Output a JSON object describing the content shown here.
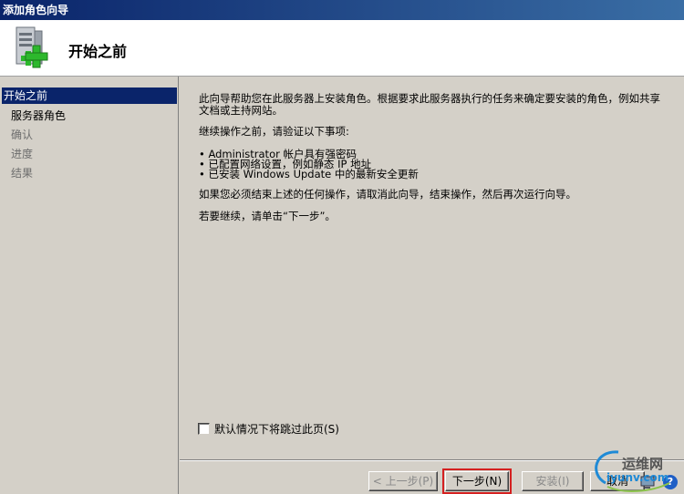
{
  "window": {
    "title": "添加角色向导"
  },
  "header": {
    "title": "开始之前",
    "icon": "server-add-icon"
  },
  "sidebar": {
    "items": [
      {
        "label": "开始之前",
        "state": "active"
      },
      {
        "label": "服务器角色",
        "state": "enabled"
      },
      {
        "label": "确认",
        "state": "disabled"
      },
      {
        "label": "进度",
        "state": "disabled"
      },
      {
        "label": "结果",
        "state": "disabled"
      }
    ]
  },
  "content": {
    "intro": "此向导帮助您在此服务器上安装角色。根据要求此服务器执行的任务来确定要安装的角色，例如共享文档或主持网站。",
    "verify_heading": "继续操作之前，请验证以下事项:",
    "bullets": [
      "• Administrator 帐户具有强密码",
      "• 已配置网络设置，例如静态 IP 地址",
      "• 已安装 Windows Update 中的最新安全更新"
    ],
    "cancel_note": "如果您必须结束上述的任何操作，请取消此向导，结束操作，然后再次运行向导。",
    "continue_note": "若要继续，请单击“下一步”。",
    "skip_checkbox_label": "默认情况下将跳过此页(S)",
    "skip_checked": false
  },
  "buttons": {
    "back": "< 上一步(P)",
    "next": "下一步(N) >",
    "install": "安装(I)",
    "cancel": "取消"
  },
  "watermark": {
    "text": "运维网",
    "url": "iyunv.com"
  },
  "colors": {
    "titlebar": "#0a246a",
    "selection": "#0a246a",
    "focus_outline": "#d42020"
  }
}
